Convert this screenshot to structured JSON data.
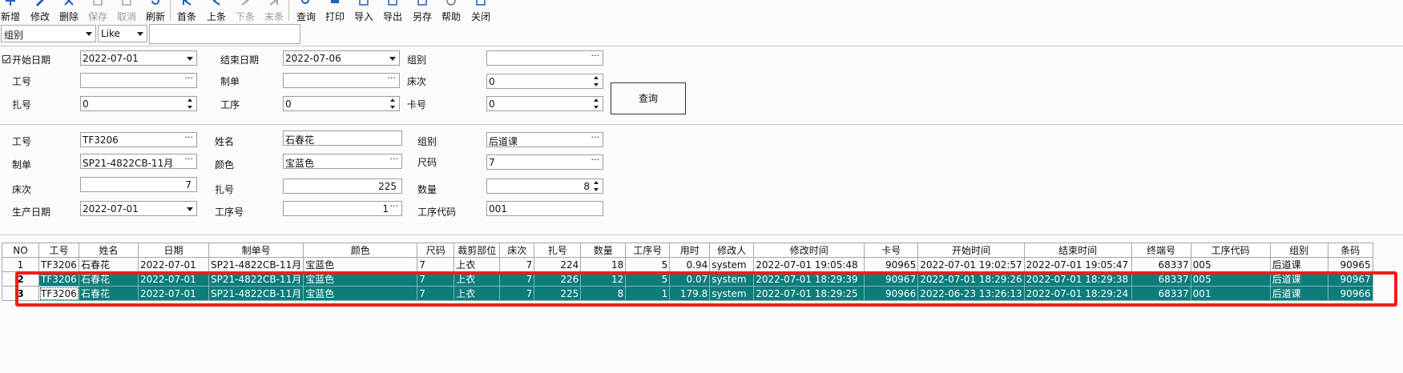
{
  "toolbar": {
    "buttons": [
      {
        "label": "新增",
        "icon": "add-icon",
        "enabled": true
      },
      {
        "label": "修改",
        "icon": "edit-icon",
        "enabled": true
      },
      {
        "label": "删除",
        "icon": "delete-icon",
        "enabled": true
      },
      {
        "label": "保存",
        "icon": "save-icon",
        "enabled": false
      },
      {
        "label": "取消",
        "icon": "cancel-icon",
        "enabled": false
      },
      {
        "label": "刷新",
        "icon": "refresh-icon",
        "enabled": true
      },
      {
        "label": "首条",
        "icon": "first-record-icon",
        "enabled": true
      },
      {
        "label": "上条",
        "icon": "previous-record-icon",
        "enabled": true
      },
      {
        "label": "下条",
        "icon": "next-record-icon",
        "enabled": false
      },
      {
        "label": "末条",
        "icon": "last-record-icon",
        "enabled": false
      },
      {
        "label": "查询",
        "icon": "search-icon",
        "enabled": true
      },
      {
        "label": "打印",
        "icon": "print-icon",
        "enabled": true
      },
      {
        "label": "导入",
        "icon": "import-icon",
        "enabled": true
      },
      {
        "label": "导出",
        "icon": "export-icon",
        "enabled": true
      },
      {
        "label": "另存",
        "icon": "save-as-icon",
        "enabled": true
      },
      {
        "label": "帮助",
        "icon": "help-icon",
        "enabled": true
      },
      {
        "label": "关闭",
        "icon": "close-icon",
        "enabled": true
      }
    ]
  },
  "filter": {
    "field": "组别",
    "operator": "Like",
    "value": ""
  },
  "query": {
    "start_date_checked": true,
    "start_date_label": "开始日期",
    "start_date": "2022-07-01",
    "end_date_label": "结束日期",
    "end_date": "2022-07-06",
    "group_label": "组别",
    "group": "",
    "worker_id_label": "工号",
    "worker_id": "",
    "order_label": "制单",
    "order": "",
    "bed_label": "床次",
    "bed": "0",
    "bundle_label": "扎号",
    "bundle": "0",
    "process_label": "工序",
    "process": "0",
    "card_label": "卡号",
    "card": "0",
    "search_button": "查询"
  },
  "detail": {
    "worker_id_label": "工号",
    "worker_id": "TF3206",
    "name_label": "姓名",
    "name": "石春花",
    "group_label": "组别",
    "group": "后道课",
    "order_label": "制单",
    "order": "SP21-4822CB-11月",
    "color_label": "颜色",
    "color": "宝蓝色",
    "size_label": "尺码",
    "size": "7",
    "bed_label": "床次",
    "bed": "7",
    "bundle_label": "扎号",
    "bundle": "225",
    "qty_label": "数量",
    "qty": "8",
    "prod_date_label": "生产日期",
    "prod_date": "2022-07-01",
    "process_no_label": "工序号",
    "process_no": "1",
    "process_code_label": "工序代码",
    "process_code": "001"
  },
  "grid": {
    "columns": [
      "NO",
      "工号",
      "姓名",
      "日期",
      "制单号",
      "颜色",
      "尺码",
      "裁剪部位",
      "床次",
      "扎号",
      "数量",
      "工序号",
      "用时",
      "修改人",
      "修改时间",
      "卡号",
      "开始时间",
      "结束时间",
      "终端号",
      "工序代码",
      "组别",
      "条码"
    ],
    "rows": [
      [
        "1",
        "TF3206",
        "石春花",
        "2022-07-01",
        "SP21-4822CB-11月",
        "宝蓝色",
        "7",
        "上衣",
        "7",
        "224",
        "18",
        "5",
        "0.94",
        "system",
        "2022-07-01 19:05:48",
        "90965",
        "2022-07-01 19:02:57",
        "2022-07-01 19:05:47",
        "68337",
        "005",
        "后道课",
        "90965"
      ],
      [
        "2",
        "TF3206",
        "石春花",
        "2022-07-01",
        "SP21-4822CB-11月",
        "宝蓝色",
        "7",
        "上衣",
        "7",
        "226",
        "12",
        "5",
        "0.07",
        "system",
        "2022-07-01 18:29:39",
        "90967",
        "2022-07-01 18:29:26",
        "2022-07-01 18:29:38",
        "68337",
        "005",
        "后道课",
        "90967"
      ],
      [
        "3",
        "TF3206",
        "石春花",
        "2022-07-01",
        "SP21-4822CB-11月",
        "宝蓝色",
        "7",
        "上衣",
        "7",
        "225",
        "8",
        "1",
        "179.8",
        "system",
        "2022-07-01 18:29:25",
        "90966",
        "2022-06-23 13:26:13",
        "2022-07-01 18:29:24",
        "68337",
        "001",
        "后道课",
        "90966"
      ]
    ],
    "selected_rows": [
      1,
      2
    ],
    "current_row": 2
  },
  "colors": {
    "selection": "#0b7d7b",
    "annotation": "#f21b1b"
  }
}
